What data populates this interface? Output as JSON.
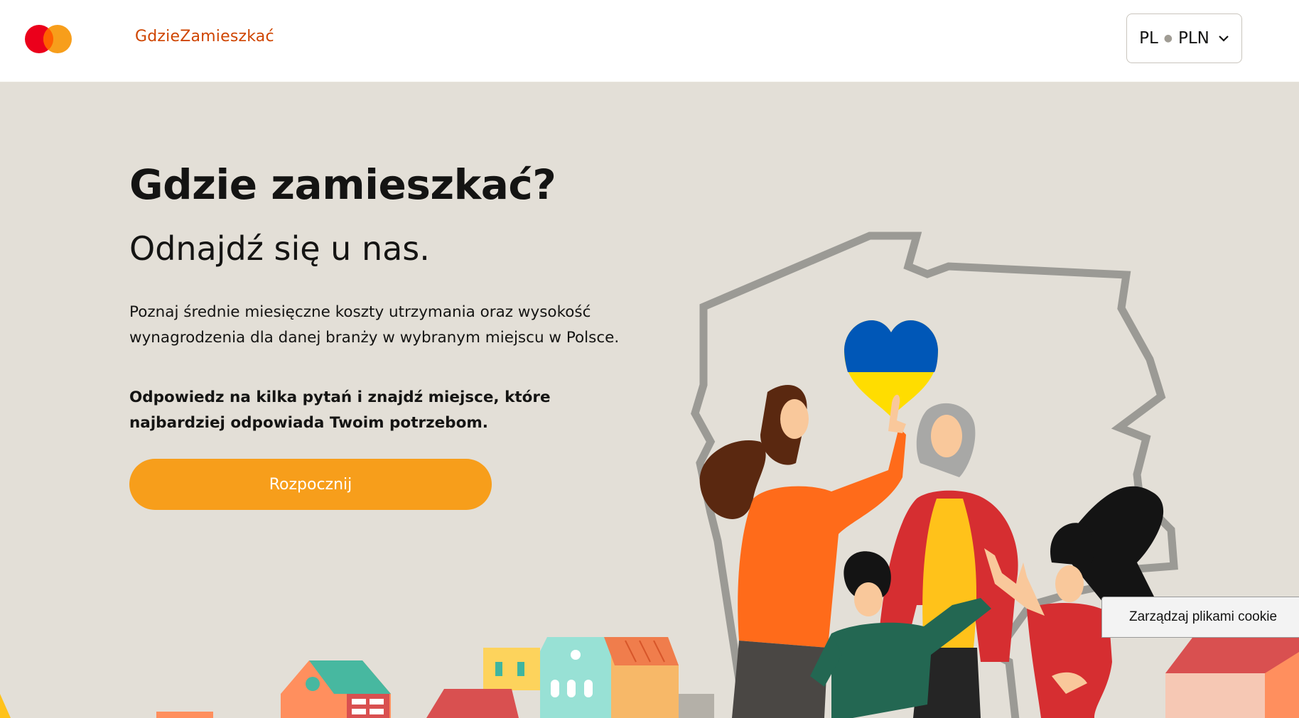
{
  "header": {
    "site_name": "GdzieZamieszkać",
    "language": "PL",
    "currency": "PLN"
  },
  "hero": {
    "title": "Gdzie zamieszkać?",
    "subtitle": "Odnajdź się u nas.",
    "description": "Poznaj średnie miesięczne koszty utrzymania oraz wysokość wynagrodzenia dla danej branży w wybranym miejscu w Polsce.",
    "cta_text": "Odpowiedz na kilka pytań i znajdź miejsce, które najbardziej odpowiada Twoim potrzebom.",
    "start_button": "Rozpocznij"
  },
  "cookie": {
    "manage_label": "Zarządzaj plikami cookie"
  },
  "icons": {
    "logo": "mastercard-logo-icon",
    "select_arrow": "chevron-down-icon",
    "illustration": "poland-map-family-illustration"
  },
  "colors": {
    "brand_text": "#cf4500",
    "button": "#f79e1b",
    "background": "#e3dfd7",
    "logo_red": "#eb001b",
    "logo_orange": "#f79e1b"
  }
}
